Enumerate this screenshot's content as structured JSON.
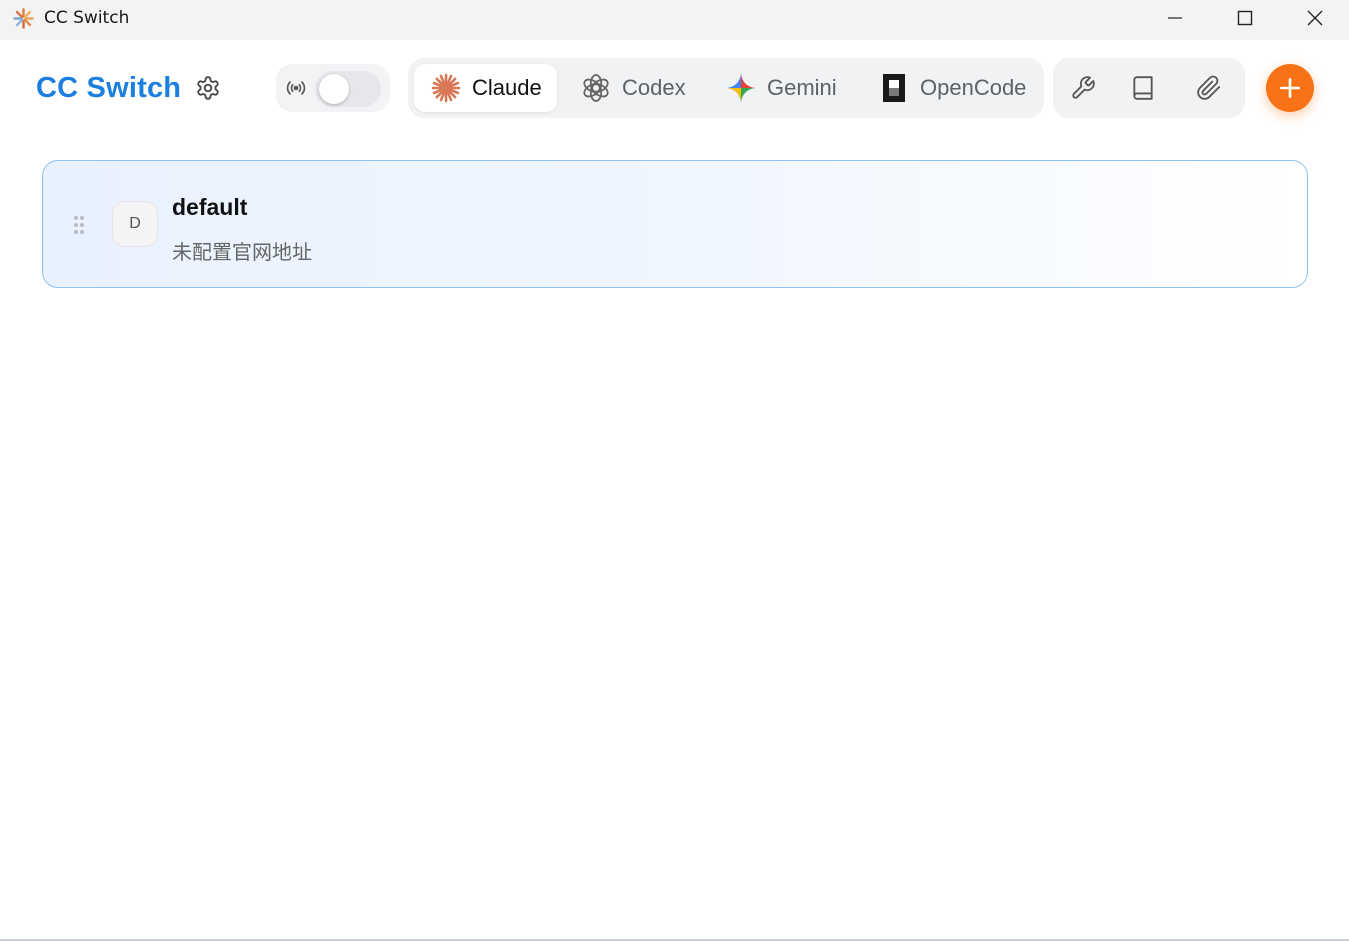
{
  "window": {
    "title": "CC Switch"
  },
  "header": {
    "brand": "CC Switch",
    "proxy_toggle": {
      "enabled": false
    }
  },
  "tabs": [
    {
      "label": "Claude",
      "icon": "claude-icon",
      "active": true,
      "color": "#D97757"
    },
    {
      "label": "Codex",
      "icon": "openai-icon",
      "active": false
    },
    {
      "label": "Gemini",
      "icon": "gemini-icon",
      "active": false
    },
    {
      "label": "OpenCode",
      "icon": "opencode-icon",
      "active": false
    }
  ],
  "tools": [
    {
      "icon": "wrench-icon"
    },
    {
      "icon": "book-icon"
    },
    {
      "icon": "paperclip-icon"
    }
  ],
  "add_button": {
    "icon": "plus-icon",
    "color": "#F97316"
  },
  "providers": [
    {
      "initial": "D",
      "name": "default",
      "subtitle": "未配置官网地址",
      "active": true
    }
  ],
  "colors": {
    "brand": "#1C7FE0",
    "accent": "#F97316",
    "card_border": "#8EC2F0"
  }
}
